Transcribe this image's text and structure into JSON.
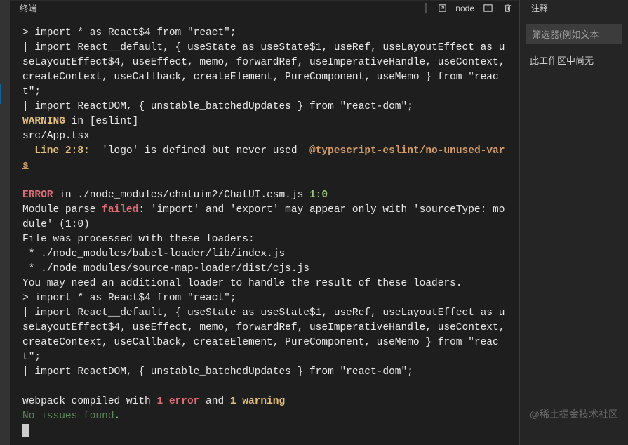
{
  "terminal_panel": {
    "title": "终端",
    "process": "node"
  },
  "comments_panel": {
    "title": "注释",
    "filter_placeholder": "筛选器(例如文本",
    "empty_message": "此工作区中尚无"
  },
  "watermark": "@稀土掘金技术社区",
  "terminal": {
    "l1": "> import * as React$4 from \"react\";",
    "l2": "| import React__default, { useState as useState$1, useRef, useLayoutEffect as useLayoutEffect$4, useEffect, memo, forwardRef, useImperativeHandle, useContext, createContext, useCallback, createElement, PureComponent, useMemo } from \"react\";",
    "l3": "| import ReactDOM, { unstable_batchedUpdates } from \"react-dom\";",
    "warning_label": "WARNING",
    "warning_in": " in [eslint]",
    "src_file": "src/App.tsx",
    "line_loc": "  Line 2:8:",
    "line_msg": "  'logo' is defined but never used  ",
    "lint_rule": "@typescript-eslint/no-unused-vars",
    "error_label": "ERROR",
    "error_in": " in ",
    "error_file": "./node_modules/chatuim2/ChatUI.esm.js",
    "error_pos": " 1:0",
    "module_parse": "Module parse ",
    "failed": "failed",
    "parse_msg": ": 'import' and 'export' may appear only with 'sourceType: module' (1:0)",
    "loaders_title": "File was processed with these loaders:",
    "loader1": " * ./node_modules/babel-loader/lib/index.js",
    "loader2": " * ./node_modules/source-map-loader/dist/cjs.js",
    "addl_loader": "You may need an additional loader to handle the result of these loaders.",
    "compiled_prefix": "webpack compiled with ",
    "err_count": "1 error",
    "and": " and ",
    "warn_count": "1 warning",
    "no_issues": "No issues found",
    "dot": "."
  }
}
